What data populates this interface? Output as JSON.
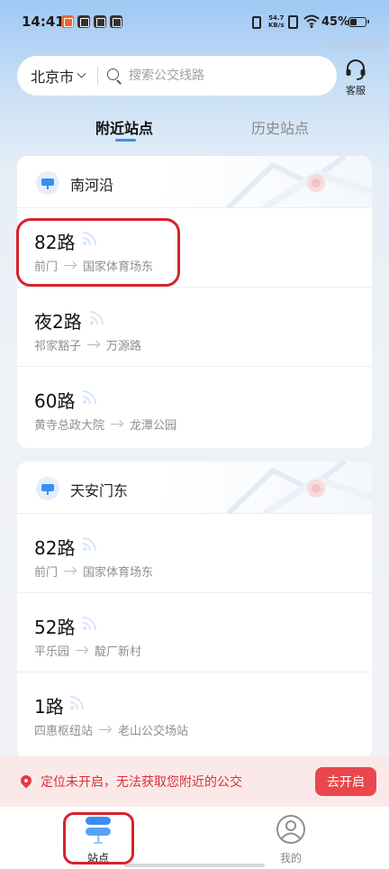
{
  "status_bar": {
    "time": "14:41",
    "net_speed_value": "54.7",
    "net_speed_unit": "KB/s",
    "battery": "45%",
    "battery_level": 0.45
  },
  "watermark": "ID:f08097",
  "search": {
    "city": "北京市",
    "placeholder": "搜索公交线路"
  },
  "service_label": "客服",
  "tabs": [
    {
      "label": "附近站点",
      "active": true
    },
    {
      "label": "历史站点",
      "active": false
    }
  ],
  "stations": [
    {
      "name": "南河沿",
      "routes": [
        {
          "name": "82路",
          "from": "前门",
          "to": "国家体育场东"
        },
        {
          "name": "夜2路",
          "from": "祁家豁子",
          "to": "万源路"
        },
        {
          "name": "60路",
          "from": "黄寺总政大院",
          "to": "龙潭公园"
        }
      ]
    },
    {
      "name": "天安门东",
      "routes": [
        {
          "name": "82路",
          "from": "前门",
          "to": "国家体育场东"
        },
        {
          "name": "52路",
          "from": "平乐园",
          "to": "靛厂新村"
        },
        {
          "name": "1路",
          "from": "四惠枢纽站",
          "to": "老山公交场站"
        }
      ]
    }
  ],
  "location_banner": {
    "message": "定位未开启，无法获取您附近的公交",
    "button": "去开启"
  },
  "bottom_nav": [
    {
      "label": "站点",
      "active": true
    },
    {
      "label": "我的",
      "active": false
    }
  ],
  "colors": {
    "accent": "#3a8ef0",
    "alert": "#e9474d",
    "highlight_ring": "#d8222a"
  }
}
